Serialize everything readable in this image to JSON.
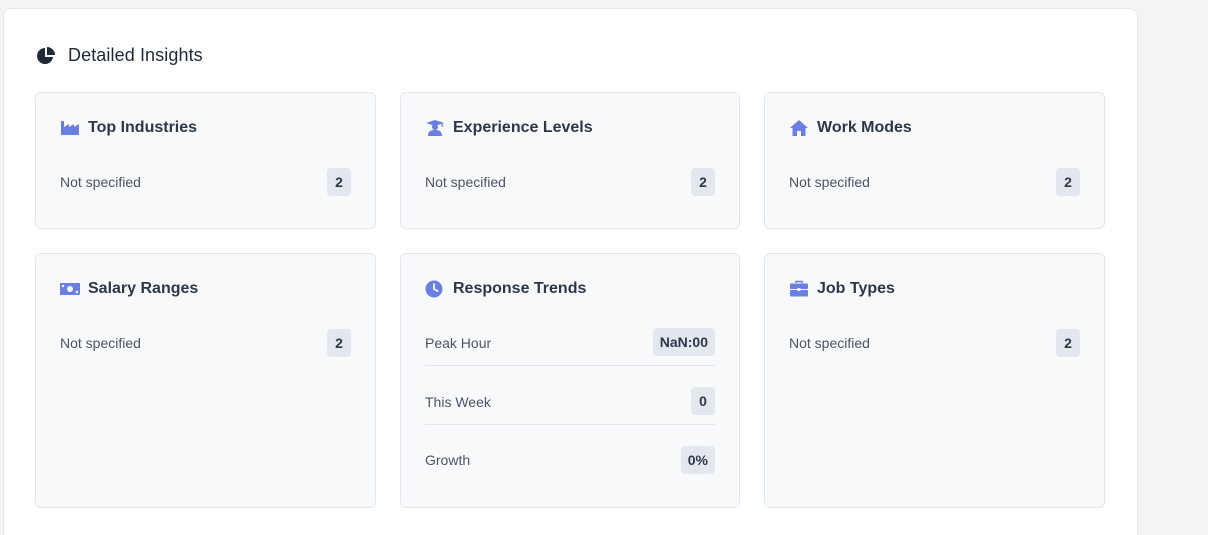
{
  "header": {
    "title": "Detailed Insights",
    "icon": "pie-chart-icon"
  },
  "accent": "#6b7fe3",
  "cards": {
    "industries": {
      "title": "Top Industries",
      "icon": "industry-icon",
      "row_label": "Not specified",
      "row_value": "2"
    },
    "experience": {
      "title": "Experience Levels",
      "icon": "graduate-icon",
      "row_label": "Not specified",
      "row_value": "2"
    },
    "work_modes": {
      "title": "Work Modes",
      "icon": "home-icon",
      "row_label": "Not specified",
      "row_value": "2"
    },
    "salary": {
      "title": "Salary Ranges",
      "icon": "money-icon",
      "row_label": "Not specified",
      "row_value": "2"
    },
    "trends": {
      "title": "Response Trends",
      "icon": "clock-icon",
      "rows": [
        {
          "label": "Peak Hour",
          "value": "NaN:00"
        },
        {
          "label": "This Week",
          "value": "0"
        },
        {
          "label": "Growth",
          "value": "0%"
        }
      ]
    },
    "job_types": {
      "title": "Job Types",
      "icon": "briefcase-icon",
      "row_label": "Not specified",
      "row_value": "2"
    }
  }
}
